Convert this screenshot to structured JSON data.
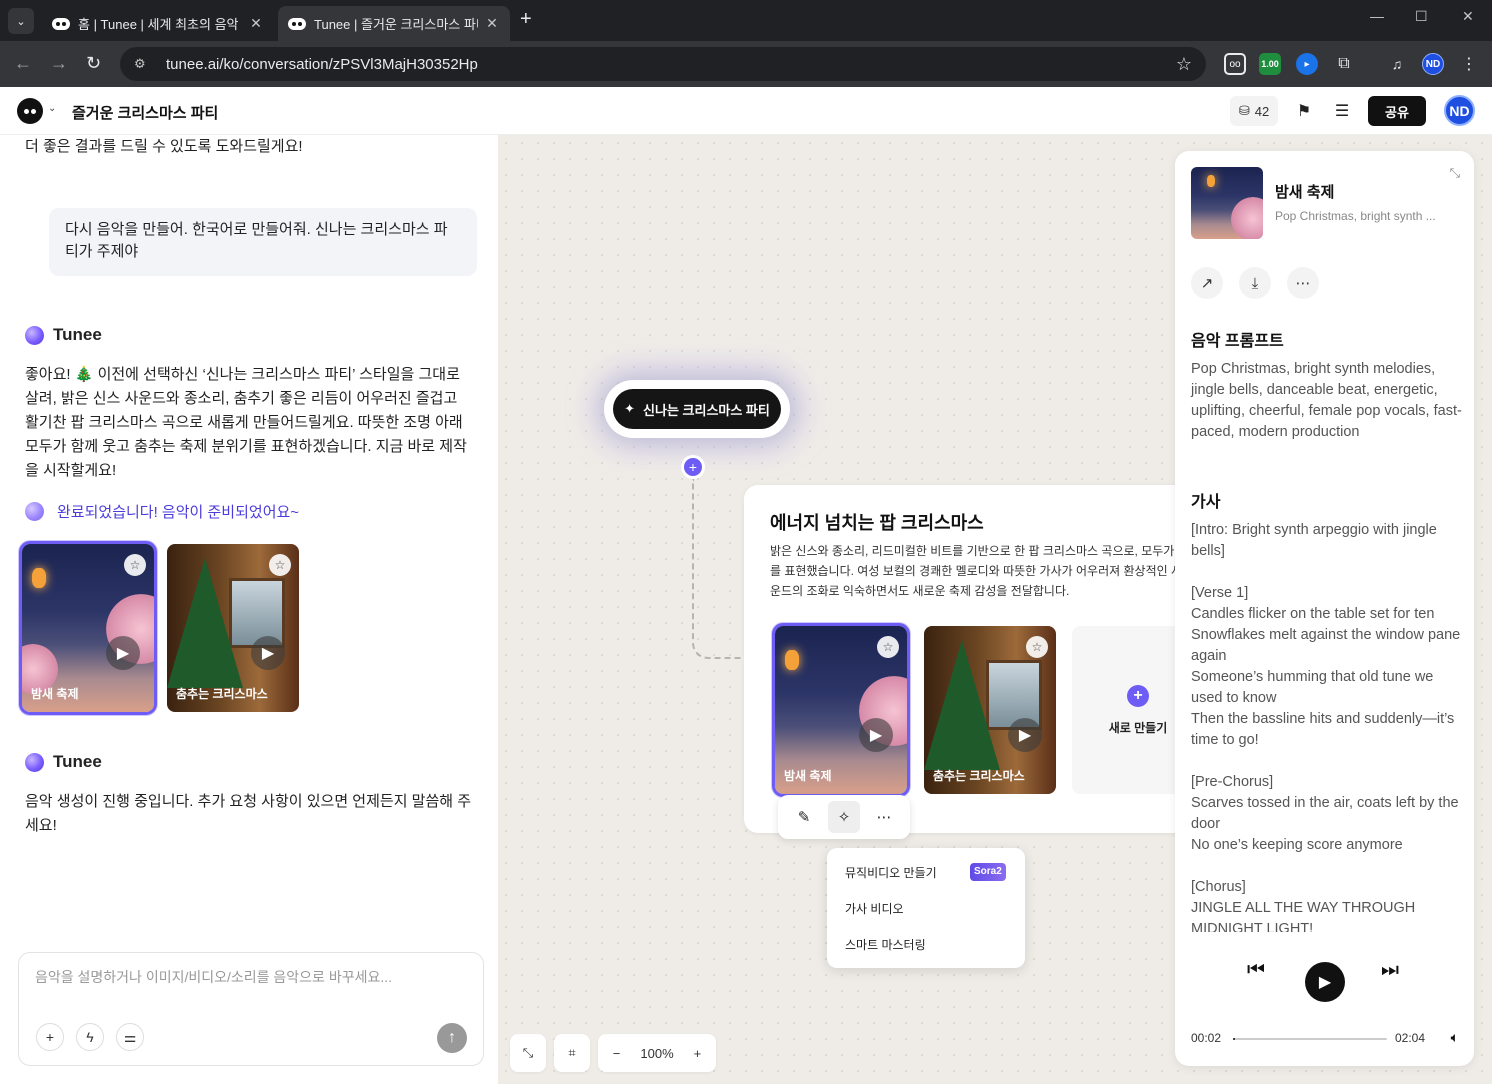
{
  "browser": {
    "tabs": [
      {
        "title": "홈 | Tunee | 세계 최초의 음악 ",
        "active": false
      },
      {
        "title": "Tunee | 즐거운 크리스마스 파티",
        "active": true
      }
    ],
    "url": "tunee.ai/ko/conversation/zPSVl3MajH30352Hp",
    "extensions": [
      {
        "name": "glasses-extension-icon",
        "label": "",
        "color": "#3c4043"
      },
      {
        "name": "counter-extension-icon",
        "label": "1.00",
        "color": "#1e8e3e"
      },
      {
        "name": "dexie-extension-icon",
        "label": "",
        "color": "#1a73e8"
      },
      {
        "name": "puzzle-extension-icon",
        "label": "",
        "color": "#3c4043"
      }
    ],
    "profile_initials": "ND"
  },
  "header": {
    "title": "즐거운 크리스마스 파티",
    "credits": "42",
    "share_label": "공유",
    "avatar_initials": "ND"
  },
  "chat": {
    "top_line": "더 좋은 결과를 드릴 수 있도록 도와드릴게요!",
    "user_message": "다시 음악을 만들어. 한국어로 만들어줘. 신나는 크리스마스 파티가 주제야",
    "bot_name": "Tunee",
    "bot_reply": "좋아요! 🎄 이전에 선택하신 ‘신나는 크리스마스 파티’ 스타일을 그대로 살려, 밝은 신스 사운드와 종소리, 춤추기 좋은 리듬이 어우러진 즐겁고 활기찬 팝 크리스마스 곡으로 새롭게 만들어드릴게요. 따뜻한 조명 아래 모두가 함께 웃고 춤추는 축제 분위기를 표현하겠습니다. 지금 바로 제작을 시작할게요!",
    "done_message": "완료되었습니다! 음악이 준비되었어요~",
    "tracks": [
      {
        "title": "밤새 축제",
        "selected": true
      },
      {
        "title": "춤추는 크리스마스",
        "selected": false
      }
    ],
    "bot_name_2": "Tunee",
    "bot_reply_2": "음악 생성이 진행 중입니다. 추가 요청 사항이 있으면 언제든지 말씀해 주세요!",
    "composer_placeholder": "음악을 설명하거나 이미지/비디오/소리를 음악으로 바꾸세요..."
  },
  "canvas": {
    "prompt_node": "신나는 크리스마스 파티",
    "card_title": "에너지 넘치는 팝 크리스마스",
    "card_description": "밝은 신스와 종소리, 리드미컬한 비트를 기반으로 한 팝 크리스마스 곡으로, 모두가 기를 표현했습니다. 여성 보컬의 경쾌한 멜로디와 따뜻한 가사가 어우러져 환상적인 사운드의 조화로 익숙하면서도 새로운 축제 감성을 전달합니다.",
    "card_tracks": [
      {
        "title": "밤새 축제",
        "selected": true
      },
      {
        "title": "춤추는 크리스마스",
        "selected": false
      }
    ],
    "new_make_label": "새로 만들기",
    "menu": {
      "items": [
        "뮤직비디오 만들기",
        "가사 비디오",
        "스마트 마스터링"
      ],
      "badge": "Sora2"
    },
    "zoom": "100%"
  },
  "player": {
    "title": "밤새 축제",
    "subtitle": "Pop Christmas, bright synth ...",
    "prompt_heading": "음악 프롬프트",
    "prompt": "Pop Christmas, bright synth melodies, jingle bells, danceable beat, energetic, uplifting, cheerful, female pop vocals, fast-paced, modern production",
    "lyrics_heading": "가사",
    "lyrics": [
      "[Intro: Bright synth arpeggio with jingle bells]",
      "",
      "[Verse 1]",
      "Candles flicker on the table set for ten",
      "Snowflakes melt against the window pane again",
      "Someone’s humming that old tune we used to know",
      "Then the bassline hits and suddenly—it’s time to go!",
      "",
      "[Pre-Chorus]",
      "Scarves tossed in the air, coats left by the door",
      "No one’s keeping score anymore",
      "",
      "[Chorus]",
      "JINGLE ALL THE WAY THROUGH MIDNIGHT LIGHT!"
    ],
    "time_current": "00:02",
    "time_total": "02:04",
    "progress": 0.016
  },
  "colors": {
    "accent": "#6d5df5",
    "dark": "#111111"
  }
}
